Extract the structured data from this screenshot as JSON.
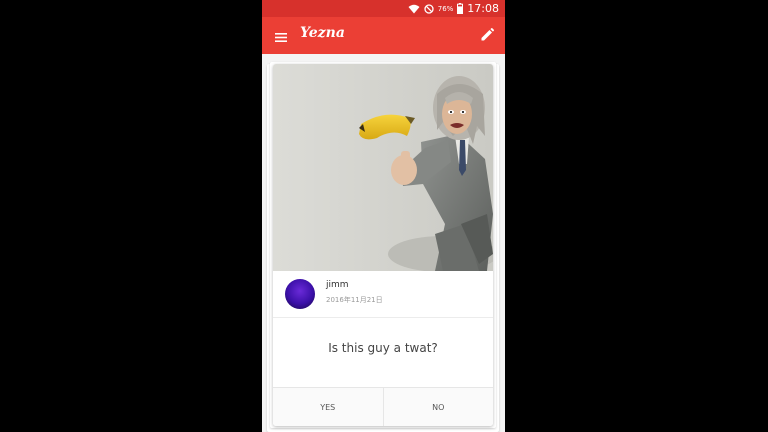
{
  "status_bar": {
    "battery_percent": "76%",
    "time": "17:08",
    "icons": [
      "wifi-icon",
      "do-not-disturb-icon",
      "battery-icon"
    ]
  },
  "app_bar": {
    "title": "Yezna",
    "icons": [
      "menu-icon",
      "edit-icon"
    ]
  },
  "post": {
    "username": "jimm",
    "date": "2016年11月21日",
    "question": "Is this guy a twat?",
    "answers": [
      {
        "label": "YES"
      },
      {
        "label": "NO"
      }
    ]
  },
  "colors": {
    "status_bar": "#d7312c",
    "app_bar": "#eb3f35",
    "background": "#f4f4f4"
  }
}
